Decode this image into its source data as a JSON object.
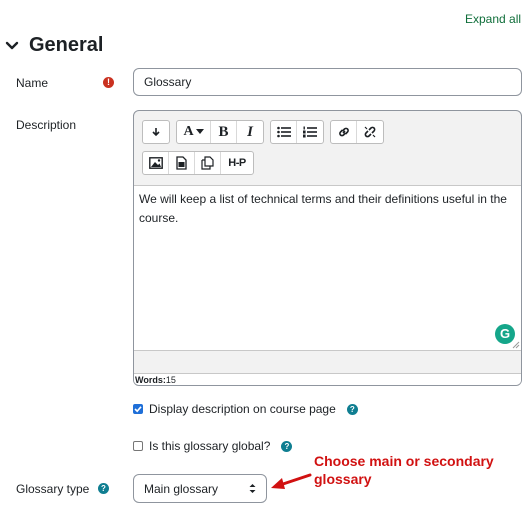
{
  "expand_all_label": "Expand all",
  "section": {
    "title": "General",
    "icon": "chevron-down-icon"
  },
  "name_field": {
    "label": "Name",
    "required_icon": "exclamation-icon",
    "value": "Glossary"
  },
  "description": {
    "label": "Description",
    "toolbar": {
      "row1": [
        {
          "name": "collapse-toolbar-button",
          "icon": "arrow-down-icon",
          "text": "↧"
        },
        {
          "name": "font-size-button",
          "icon": "font-icon",
          "text": "A▾"
        },
        {
          "name": "bold-button",
          "icon": "bold-icon",
          "text": "B"
        },
        {
          "name": "italic-button",
          "icon": "italic-icon",
          "text": "I"
        },
        {
          "name": "bullet-list-button",
          "icon": "list-ul-icon",
          "text": ""
        },
        {
          "name": "numbered-list-button",
          "icon": "list-ol-icon",
          "text": ""
        },
        {
          "name": "link-button",
          "icon": "link-icon",
          "text": ""
        },
        {
          "name": "unlink-button",
          "icon": "unlink-icon",
          "text": ""
        }
      ],
      "row2": [
        {
          "name": "image-button",
          "icon": "image-icon",
          "text": ""
        },
        {
          "name": "media-button",
          "icon": "file-media-icon",
          "text": ""
        },
        {
          "name": "manage-files-button",
          "icon": "copy-files-icon",
          "text": ""
        },
        {
          "name": "h5p-button",
          "icon": "h5p-icon",
          "text": "H-P"
        }
      ]
    },
    "content": "We will keep a list of technical terms and their definitions useful in the course.",
    "word_count_label": "Words:",
    "word_count": "15",
    "grammarly_letter": "G"
  },
  "display_description": {
    "label": "Display description on course page",
    "checked": true,
    "help_icon": "question-icon"
  },
  "global_glossary": {
    "label": "Is this glossary global?",
    "checked": false,
    "help_icon": "question-icon"
  },
  "glossary_type": {
    "label": "Glossary type",
    "help_icon": "question-icon",
    "selected": "Main glossary"
  },
  "annotation": {
    "text": "Choose main or secondary glossary",
    "color": "#d11111"
  }
}
